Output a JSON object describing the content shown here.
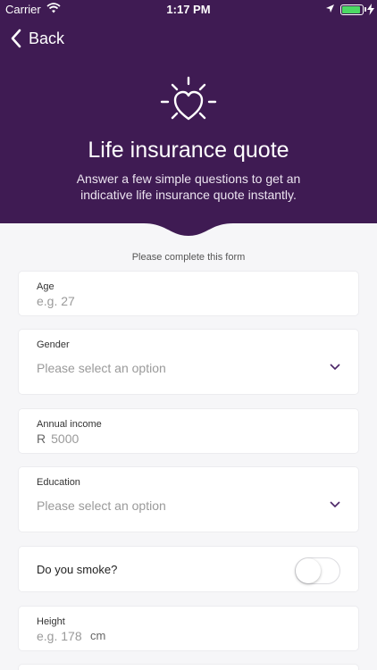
{
  "status_bar": {
    "carrier": "Carrier",
    "time": "1:17 PM",
    "battery_level": 0.9,
    "battery_color": "#4cd964"
  },
  "nav": {
    "back_label": "Back",
    "back_icon": "chevron-left-icon"
  },
  "hero": {
    "icon": "heart-shine-icon",
    "title": "Life insurance quote",
    "subtitle": "Answer a few simple questions to get an indicative life insurance quote instantly."
  },
  "form": {
    "caption": "Please complete this form",
    "age": {
      "label": "Age",
      "placeholder": "e.g. 27"
    },
    "gender": {
      "label": "Gender",
      "placeholder": "Please select an option"
    },
    "income": {
      "label": "Annual income",
      "prefix": "R",
      "placeholder": "5000"
    },
    "education": {
      "label": "Education",
      "placeholder": "Please select an option"
    },
    "smoke": {
      "label": "Do you smoke?",
      "value": false
    },
    "height": {
      "label": "Height",
      "placeholder": "e.g. 178",
      "unit": "cm"
    }
  },
  "colors": {
    "brand": "#3f1b53",
    "accent": "#4a2466",
    "background": "#f6f6f8"
  }
}
